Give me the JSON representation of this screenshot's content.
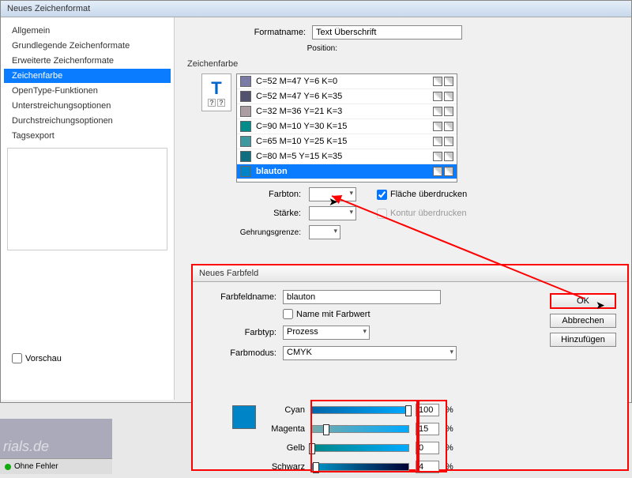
{
  "main": {
    "title": "Neues Zeichenformat",
    "sidebar": [
      "Allgemein",
      "Grundlegende Zeichenformate",
      "Erweiterte Zeichenformate",
      "Zeichenfarbe",
      "OpenType-Funktionen",
      "Unterstreichungsoptionen",
      "Durchstreichungsoptionen",
      "Tagsexport"
    ],
    "sidebar_selected": 3,
    "preview_label": "Vorschau",
    "formatname_label": "Formatname:",
    "formatname_value": "Text Überschrift",
    "position_label": "Position:",
    "section_label": "Zeichenfarbe",
    "swatches": [
      {
        "label": "C=52 M=47 Y=6 K=0",
        "color": "#7a7aa6"
      },
      {
        "label": "C=52 M=47 Y=6 K=35",
        "color": "#52526e"
      },
      {
        "label": "C=32 M=36 Y=21 K=3",
        "color": "#ab9da1"
      },
      {
        "label": "C=90 M=10 Y=30 K=15",
        "color": "#008d8a"
      },
      {
        "label": "C=65 M=10 Y=25 K=15",
        "color": "#3d98a0"
      },
      {
        "label": "C=80 M=5 Y=15 K=35",
        "color": "#0d6e82"
      },
      {
        "label": "blauton",
        "color": "#0084c8"
      }
    ],
    "swatch_selected": 6,
    "farbton_label": "Farbton:",
    "staerke_label": "Stärke:",
    "gehrung_label": "Gehrungsgrenze:",
    "flaeche_chk": "Fläche überdrucken",
    "kontur_chk": "Kontur überdrucken"
  },
  "dialog": {
    "title": "Neues Farbfeld",
    "farbfeldname_label": "Farbfeldname:",
    "farbfeldname_value": "blauton",
    "name_mit_farbwert": "Name mit Farbwert",
    "farbtyp_label": "Farbtyp:",
    "farbtyp_value": "Prozess",
    "farbmodus_label": "Farbmodus:",
    "farbmodus_value": "CMYK",
    "btn_ok": "OK",
    "btn_cancel": "Abbrechen",
    "btn_add": "Hinzufügen",
    "sliders": {
      "cyan": {
        "label": "Cyan",
        "value": "100",
        "pct": 100
      },
      "magenta": {
        "label": "Magenta",
        "value": "15",
        "pct": 15
      },
      "gelb": {
        "label": "Gelb",
        "value": "0",
        "pct": 0
      },
      "schwarz": {
        "label": "Schwarz",
        "value": "4",
        "pct": 4
      }
    }
  },
  "status": {
    "text": "Ohne Fehler"
  },
  "watermark": "rials.de"
}
